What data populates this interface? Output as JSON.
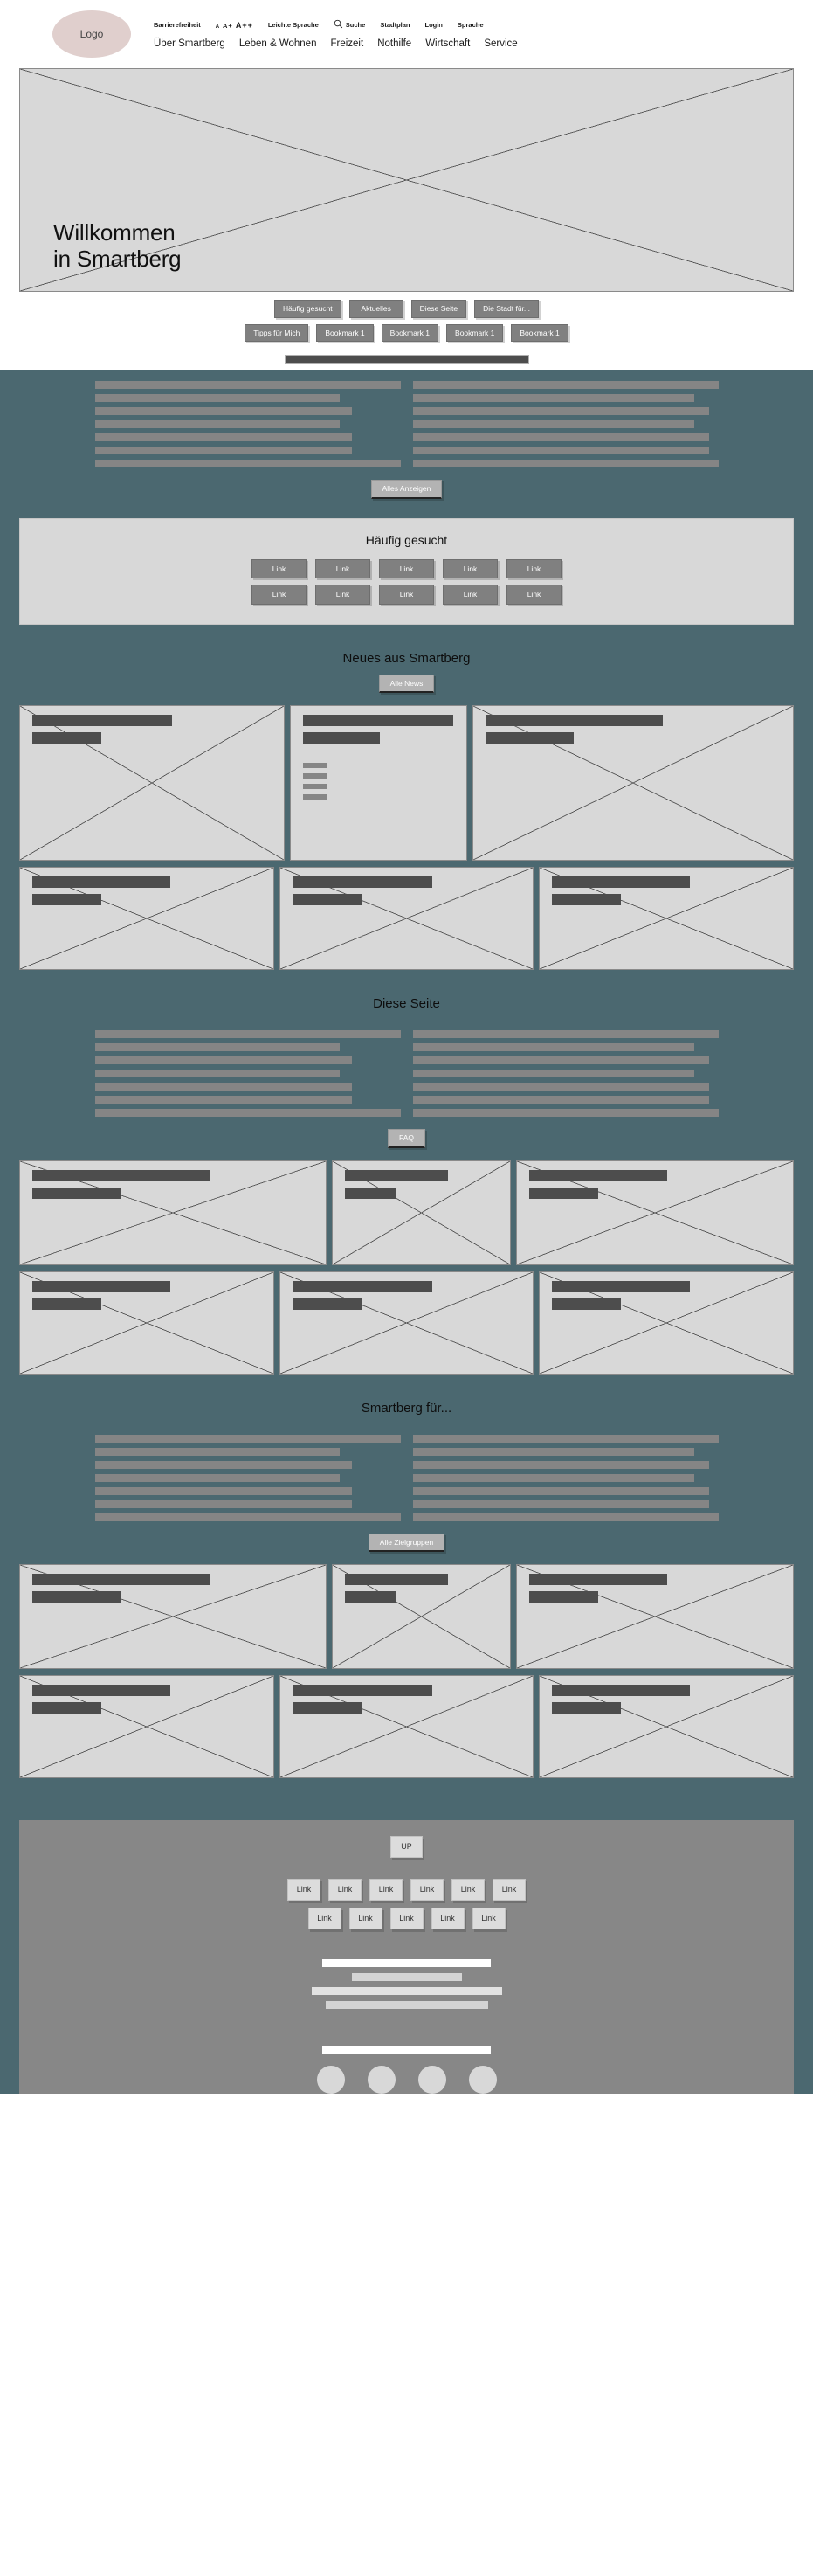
{
  "header": {
    "logo_label": "Logo",
    "meta_nav": [
      {
        "label": "Barrierefreiheit",
        "icon": null
      },
      {
        "label": "A A+ A++",
        "icon": "font-size-icon"
      },
      {
        "label": "Leichte Sprache",
        "icon": null
      },
      {
        "label": "Suche",
        "icon": "search-icon"
      },
      {
        "label": "Stadtplan",
        "icon": null
      },
      {
        "label": "Login",
        "icon": null
      },
      {
        "label": "Sprache",
        "icon": null
      }
    ],
    "font_sizes": {
      "small": "A",
      "medium": "A+",
      "large": "A++"
    },
    "main_nav": [
      "Über Smartberg",
      "Leben & Wohnen",
      "Freizeit",
      "Nothilfe",
      "Wirtschaft",
      "Service"
    ]
  },
  "hero": {
    "title_line1": "Willkommen",
    "title_line2": "in Smartberg"
  },
  "quick_access": {
    "row1": [
      "Häufig gesucht",
      "Aktuelles",
      "Diese Seite",
      "Die Stadt für..."
    ],
    "row2": [
      "Tipps für Mich",
      "Bookmark 1",
      "Bookmark 1",
      "Bookmark 1",
      "Bookmark 1"
    ]
  },
  "intro": {
    "show_all_label": "Alles Anzeigen"
  },
  "haeufig_gesucht": {
    "title": "Häufig gesucht",
    "row1": [
      "Link",
      "Link",
      "Link",
      "Link",
      "Link"
    ],
    "row2": [
      "Link",
      "Link",
      "Link",
      "Link",
      "Link"
    ]
  },
  "news": {
    "title": "Neues aus Smartberg",
    "button_label": "Alle News"
  },
  "diese_seite": {
    "title": "Diese Seite",
    "button_label": "FAQ"
  },
  "zielgruppen": {
    "title": "Smartberg für...",
    "button_label": "Alle Zielgruppen"
  },
  "footer": {
    "up_label": "UP",
    "links_row1": [
      "Link",
      "Link",
      "Link",
      "Link",
      "Link",
      "Link"
    ],
    "links_row2": [
      "Link",
      "Link",
      "Link",
      "Link",
      "Link"
    ],
    "social_circles": 4
  },
  "colors": {
    "page_background": "#ffffff",
    "body_teal": "#4b6870",
    "logo_pink": "#e0cfcd",
    "placeholder_grey": "#d8d8d8",
    "bar_grey": "#858585",
    "bar_dark": "#4d4d4d",
    "button_grey": "#808080",
    "footer_grey": "#878787"
  }
}
